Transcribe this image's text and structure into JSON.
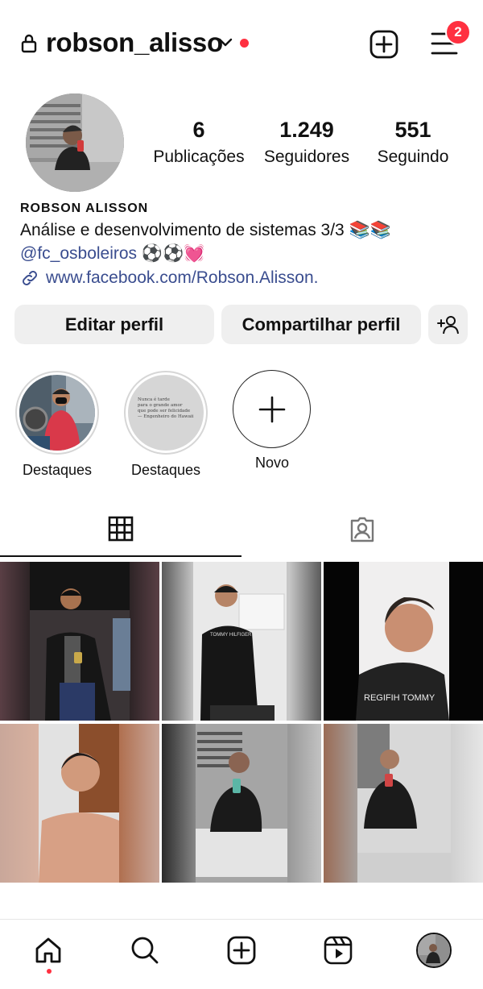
{
  "header": {
    "username": "robson_alisso",
    "notification_count": "2",
    "accent_color": "#ff3040"
  },
  "profile": {
    "stats": [
      {
        "value": "6",
        "label": "Publicações"
      },
      {
        "value": "1.249",
        "label": "Seguidores"
      },
      {
        "value": "551",
        "label": "Seguindo"
      }
    ],
    "name": "ROBSON ALISSON",
    "bio": "Análise e desenvolvimento de sistemas 3/3 📚📚",
    "mention": "@fc_osboleiros ⚽⚽💓",
    "link": "www.facebook.com/Robson.Alisson."
  },
  "buttons": {
    "edit": "Editar perfil",
    "share": "Compartilhar perfil"
  },
  "highlights": [
    {
      "label": "Destaques",
      "inner_text": ""
    },
    {
      "label": "Destaques",
      "inner_text": "Nunca é tarde\npara o grande amor\nque pode ser felicidade\n— Engenheiro do Hawaii"
    },
    {
      "label": "Novo",
      "inner_text": ""
    }
  ],
  "tabs": [
    {
      "name": "grid-icon",
      "active": true
    },
    {
      "name": "tagged-icon",
      "active": false
    }
  ],
  "posts": [
    {
      "shirt_text": ""
    },
    {
      "shirt_text": "TOMMY HILFIGER"
    },
    {
      "shirt_text": "REGIFIH TOMMY"
    },
    {
      "shirt_text": ""
    },
    {
      "shirt_text": ""
    },
    {
      "shirt_text": ""
    }
  ],
  "nav": [
    "home-icon",
    "search-icon",
    "create-icon",
    "reels-icon",
    "profile-avatar"
  ]
}
